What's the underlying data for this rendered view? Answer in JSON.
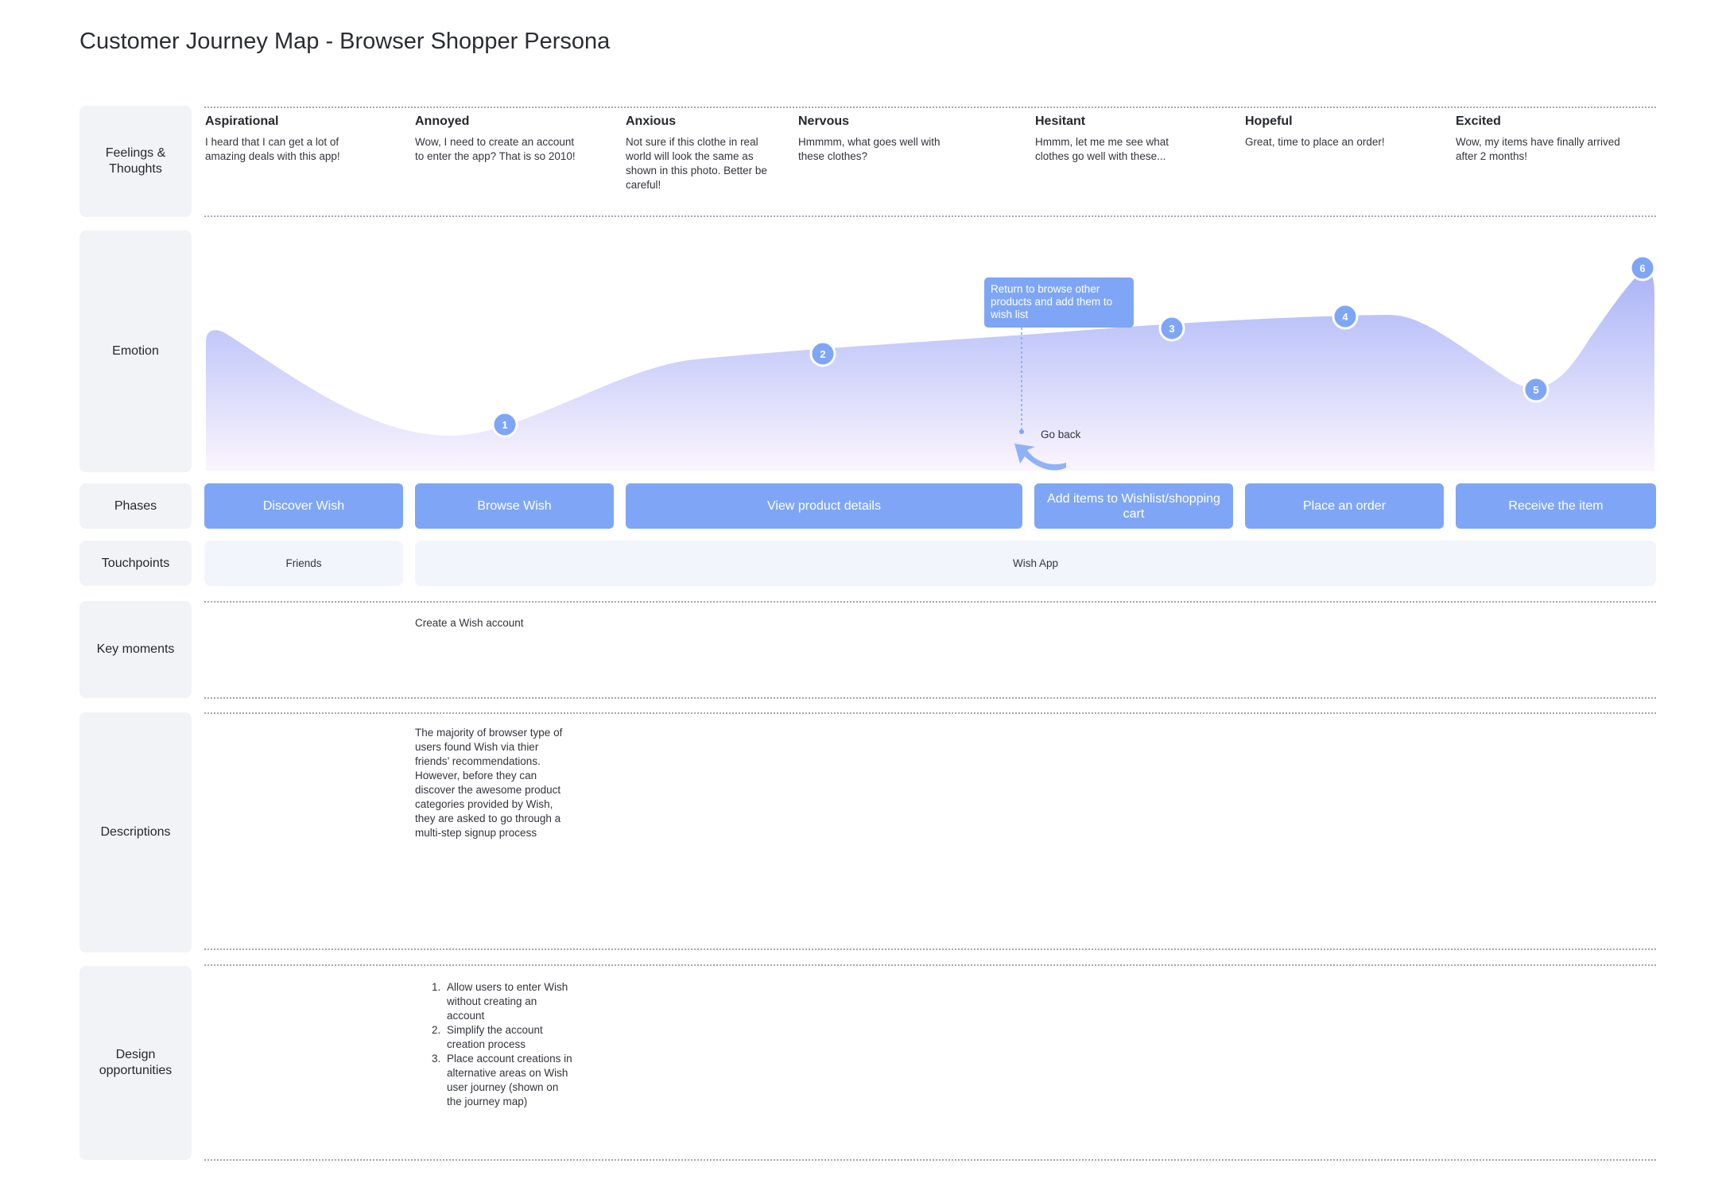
{
  "title": "Customer Journey Map - Browser Shopper Persona",
  "rows": {
    "feelings": "Feelings &\nThoughts",
    "emotion": "Emotion",
    "phases": "Phases",
    "touchpoints": "Touchpoints",
    "key_moments": "Key moments",
    "descriptions": "Descriptions",
    "design_opportunities": "Design\nopportunities"
  },
  "feelings": [
    {
      "heading": "Aspirational",
      "text": "I heard that I can get a lot of amazing deals with this app!"
    },
    {
      "heading": "Annoyed",
      "text": "Wow, I need to create an account to enter the app? That is so 2010!"
    },
    {
      "heading": "Anxious",
      "text": "Not sure if this clothe in real world will look the same as shown in this photo. Better be careful!"
    },
    {
      "heading": "Nervous",
      "text": "Hmmmm, what goes well with these clothes?"
    },
    {
      "heading": "Hesitant",
      "text": "Hmmm, let me me see what clothes go well with these..."
    },
    {
      "heading": "Hopeful",
      "text": "Great, time to place an order!"
    },
    {
      "heading": "Excited",
      "text": "Wow, my items have finally arrived after 2 months!"
    }
  ],
  "emotion_markers": [
    "1",
    "2",
    "3",
    "4",
    "5",
    "6"
  ],
  "emotion_colors": {
    "fill_top": "#a9b4f7",
    "fill_bottom": "#fbf5fe",
    "marker": "#7fa6f6"
  },
  "callout": "Return to browse other products and add them to wish list",
  "go_back": "Go back",
  "phases": [
    "Discover Wish",
    "Browse Wish",
    "View product details",
    "Add items to Wishlist/shopping cart",
    "Place an order",
    "Receive the item"
  ],
  "touchpoints": [
    "Friends",
    "Wish App"
  ],
  "key_moment": "Create a Wish account",
  "description": "The majority of browser type of users found Wish via thier friends’ recommendations. However, before they can discover the awesome product categories provided by Wish, they are asked to go through a multi-step signup process",
  "opportunities": [
    "Allow users to enter Wish without creating an account",
    "Simplify the account creation process",
    "Place account creations in alternative areas on Wish user journey (shown on the journey map)"
  ]
}
